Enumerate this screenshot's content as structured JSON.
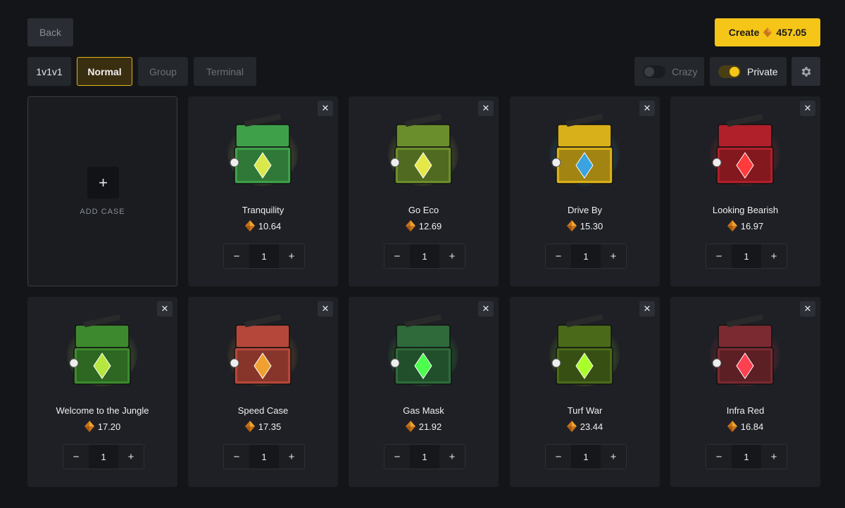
{
  "header": {
    "back_label": "Back",
    "create_label": "Create",
    "create_amount": "457.05"
  },
  "modes": [
    {
      "label": "1v1v1",
      "active": false
    },
    {
      "label": "Normal",
      "active": true
    },
    {
      "label": "Group",
      "active": false
    },
    {
      "label": "Terminal",
      "active": false
    }
  ],
  "toggles": {
    "crazy": {
      "label": "Crazy",
      "on": false
    },
    "private": {
      "label": "Private",
      "on": true
    }
  },
  "add_case": {
    "label": "ADD CASE",
    "icon": "plus-icon"
  },
  "cases": [
    {
      "name": "Tranquility",
      "price": "10.64",
      "qty": "1",
      "color": "#3fa04a",
      "accent": "#d9e84a"
    },
    {
      "name": "Go Eco",
      "price": "12.69",
      "qty": "1",
      "color": "#6b8e2c",
      "accent": "#e6e84a"
    },
    {
      "name": "Drive By",
      "price": "15.30",
      "qty": "1",
      "color": "#d8b01a",
      "accent": "#3aa3e0"
    },
    {
      "name": "Looking Bearish",
      "price": "16.97",
      "qty": "1",
      "color": "#b0202a",
      "accent": "#ff3b3b"
    },
    {
      "name": "Welcome to the Jungle",
      "price": "17.20",
      "qty": "1",
      "color": "#3d8a2e",
      "accent": "#b6e640"
    },
    {
      "name": "Speed Case",
      "price": "17.35",
      "qty": "1",
      "color": "#b5473a",
      "accent": "#f0a030"
    },
    {
      "name": "Gas Mask",
      "price": "21.92",
      "qty": "1",
      "color": "#2e6a3a",
      "accent": "#4cff4c"
    },
    {
      "name": "Turf War",
      "price": "23.44",
      "qty": "1",
      "color": "#4a6a1a",
      "accent": "#a8ff2a"
    },
    {
      "name": "Infra Red",
      "price": "16.84",
      "qty": "1",
      "color": "#7a2a30",
      "accent": "#ff4050"
    }
  ],
  "colors": {
    "accent": "#f5c518",
    "background": "#141518",
    "card": "#1e2025"
  }
}
